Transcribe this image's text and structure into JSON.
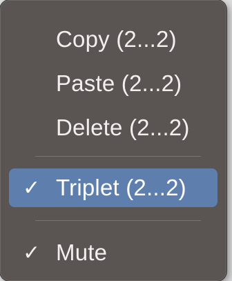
{
  "menu": {
    "items": [
      {
        "label": "Copy (2...2)",
        "checked": false,
        "highlighted": false
      },
      {
        "label": "Paste (2...2)",
        "checked": false,
        "highlighted": false
      },
      {
        "label": "Delete (2...2)",
        "checked": false,
        "highlighted": false
      },
      {
        "label": "Triplet (2...2)",
        "checked": true,
        "highlighted": true
      },
      {
        "label": "Mute",
        "checked": true,
        "highlighted": false
      }
    ],
    "check_glyph": "✓"
  },
  "colors": {
    "menu_background": "#5a5452",
    "highlight": "#5e7fad",
    "text": "#f2efee"
  }
}
